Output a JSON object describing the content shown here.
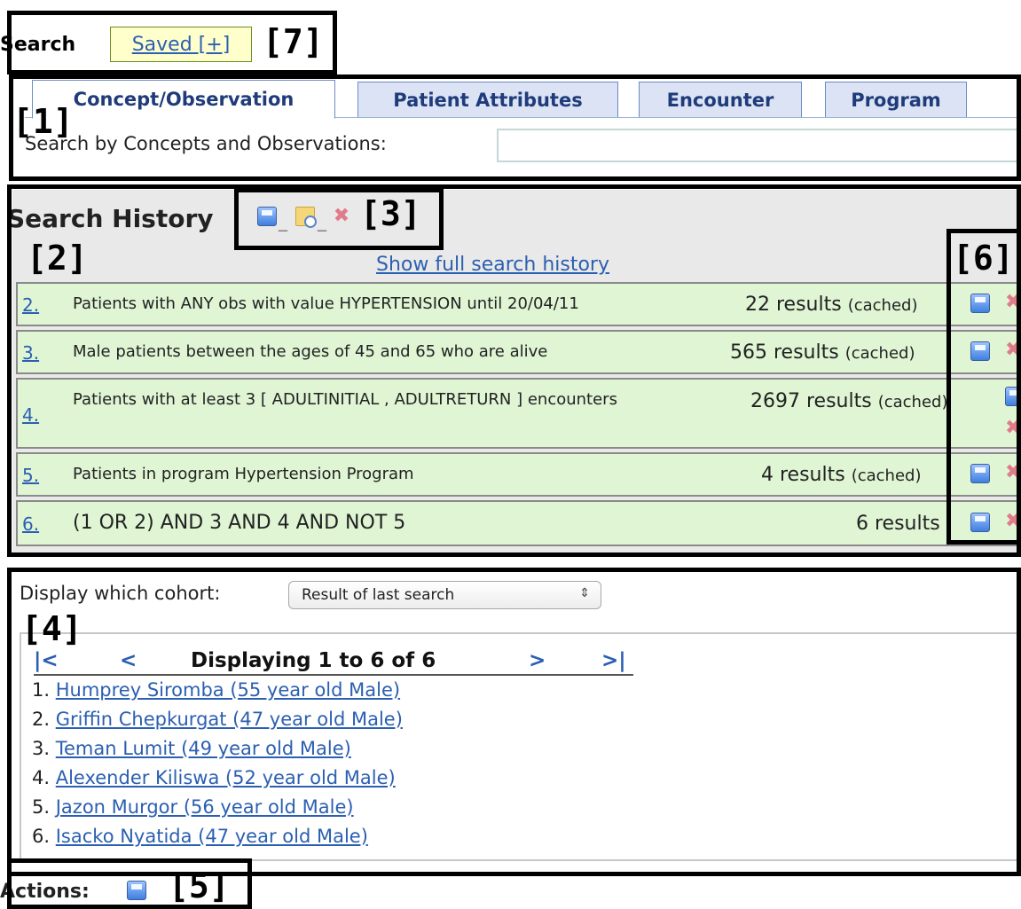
{
  "header": {
    "search_word": "Search",
    "saved_link": "Saved [+]"
  },
  "tabs": [
    {
      "label": "Concept/Observation",
      "active": true
    },
    {
      "label": "Patient Attributes",
      "active": false
    },
    {
      "label": "Encounter",
      "active": false
    },
    {
      "label": "Program",
      "active": false
    }
  ],
  "concept_search": {
    "label": "Search by Concepts and Observations:",
    "value": ""
  },
  "history": {
    "title": "Search History",
    "toolbar_icons": [
      "save-icon",
      "open-saved-icon",
      "delete-icon"
    ],
    "show_full_link": "Show full search history",
    "rows": [
      {
        "num": "2.",
        "desc": "Patients with ANY obs with value HYPERTENSION until 20/04/11",
        "result": "22 results",
        "status": "(cached)"
      },
      {
        "num": "3.",
        "desc": "Male patients between the ages of 45 and 65 who are alive",
        "result": "565 results",
        "status": "(cached)"
      },
      {
        "num": "4.",
        "desc": "Patients with at least 3 [ ADULTINITIAL , ADULTRETURN ] encounters",
        "result": "2697 results",
        "status": "(cached)"
      },
      {
        "num": "5.",
        "desc": "Patients in program Hypertension Program",
        "result": "4 results",
        "status": "(cached)"
      },
      {
        "num": "6.",
        "desc": "(1 OR 2) AND 3 AND 4 AND NOT 5",
        "result": "6 results",
        "status": ""
      }
    ]
  },
  "cohort": {
    "label": "Display which cohort:",
    "selected": "Result of last search"
  },
  "pager": {
    "first": "|<",
    "prev": "<",
    "title": "Displaying 1 to 6 of 6",
    "next": ">",
    "last": ">|"
  },
  "patients": [
    {
      "idx": "1.",
      "name": "Humprey Siromba (55 year old Male)"
    },
    {
      "idx": "2.",
      "name": "Griffin Chepkurgat (47 year old Male)"
    },
    {
      "idx": "3.",
      "name": "Teman Lumit (49 year old Male)"
    },
    {
      "idx": "4.",
      "name": "Alexender Kiliswa (52 year old Male)"
    },
    {
      "idx": "5.",
      "name": "Jazon Murgor (56 year old Male)"
    },
    {
      "idx": "6.",
      "name": "Isacko Nyatida (47 year old Male)"
    }
  ],
  "actions": {
    "label": "Actions:"
  },
  "annotations": [
    "[1]",
    "[2]",
    "[3]",
    "[4]",
    "[5]",
    "[6]",
    "[7]"
  ],
  "colors": {
    "link": "#2b5fb1",
    "row_bg": "#dff5d4",
    "history_bg": "#e9e9e9",
    "tab_bg": "#dbe3f4",
    "saved_bg": "#ffffcc",
    "delete": "#e07b8a"
  }
}
